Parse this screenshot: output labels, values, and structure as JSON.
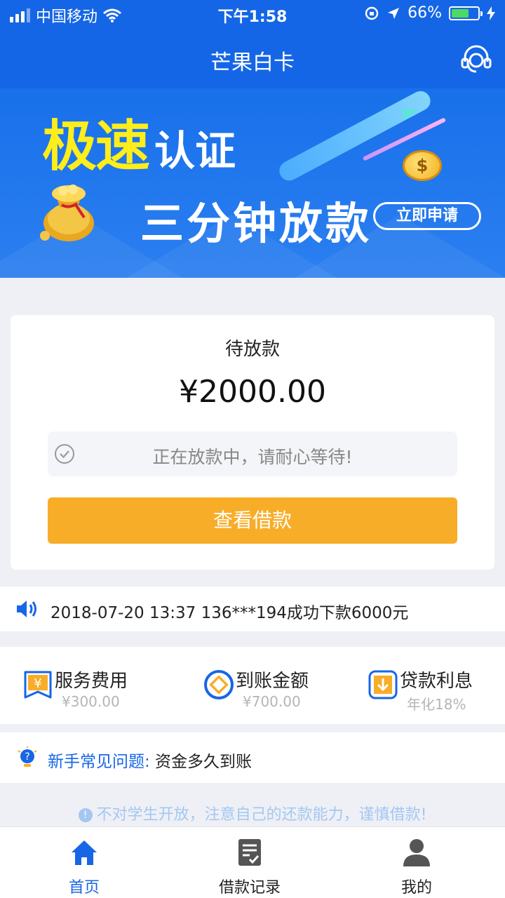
{
  "status_bar": {
    "carrier": "中国移动",
    "time": "下午1:58",
    "battery": "66%",
    "battery_level": 0.66
  },
  "header": {
    "title": "芒果白卡"
  },
  "banner": {
    "headline_yellow": "极速",
    "headline_white": "认证",
    "subheadline": "三分钟放款",
    "apply_button": "立即申请"
  },
  "loan_card": {
    "status_label": "待放款",
    "amount": "¥2000.00",
    "notice": "正在放款中，请耐心等待!",
    "view_button": "查看借款"
  },
  "ticker": {
    "text": "2018-07-20 13:37 136***194成功下款6000元"
  },
  "fees": [
    {
      "title": "服务费用",
      "value": "¥300.00"
    },
    {
      "title": "到账金额",
      "value": "¥700.00"
    },
    {
      "title": "贷款利息",
      "value": "年化18%"
    }
  ],
  "faq": {
    "label": "新手常见问题:",
    "question": " 资金多久到账"
  },
  "warning": "不对学生开放，注意自己的还款能力，谨慎借款!",
  "tabs": [
    {
      "label": "首页",
      "active": true
    },
    {
      "label": "借款记录",
      "active": false
    },
    {
      "label": "我的",
      "active": false
    }
  ],
  "colors": {
    "primary_blue": "#1566e6",
    "button_orange": "#f8ad28",
    "headline_yellow": "#ffee1a"
  }
}
